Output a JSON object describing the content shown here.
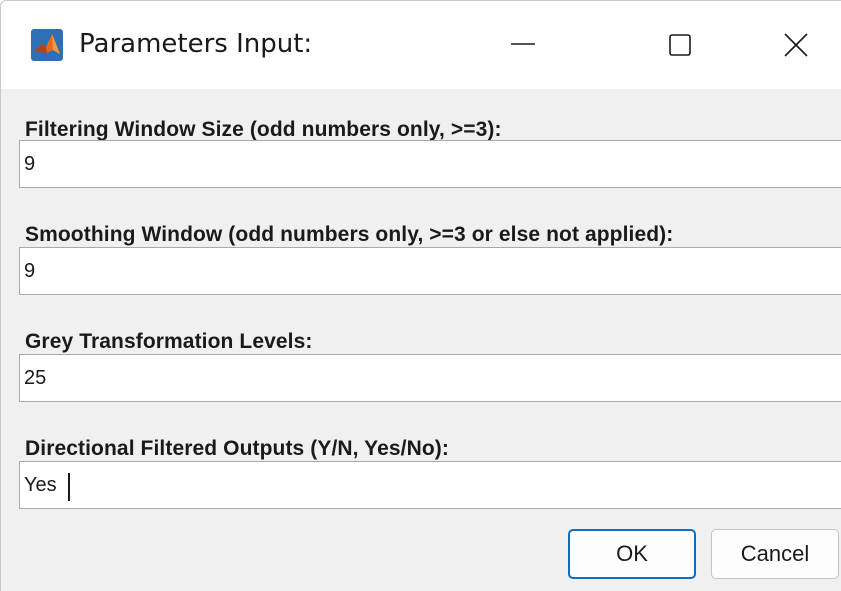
{
  "window": {
    "title": "Parameters Input:",
    "icon": "matlab-icon"
  },
  "fields": [
    {
      "label": "Filtering Window Size (odd numbers only, >=3):",
      "value": "9"
    },
    {
      "label": "Smoothing Window (odd numbers only, >=3 or else not applied):",
      "value": "9"
    },
    {
      "label": "Grey Transformation Levels:",
      "value": "25"
    },
    {
      "label": "Directional Filtered Outputs (Y/N, Yes/No):",
      "value": "Yes"
    }
  ],
  "buttons": {
    "ok": "OK",
    "cancel": "Cancel"
  },
  "colors": {
    "accent": "#0a6ec4",
    "dialog_bg": "#f0f0f0",
    "titlebar_bg": "#ffffff"
  }
}
